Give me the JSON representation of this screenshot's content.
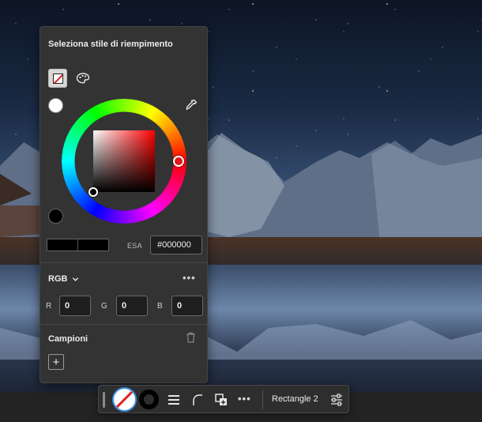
{
  "fill_panel": {
    "title": "Seleziona stile di riempimento",
    "hex_label": "ESA",
    "hex_value": "#000000",
    "color_mode": "RGB",
    "channels": [
      {
        "label": "R",
        "value": "0"
      },
      {
        "label": "G",
        "value": "0"
      },
      {
        "label": "B",
        "value": "0"
      }
    ],
    "swatches_title": "Campioni",
    "add_symbol": "+",
    "more_symbol": "•••",
    "colors": {
      "panel_bg": "#333333",
      "selected_color": "#000000",
      "hue_color": "#ff0000",
      "accent": "#3a8ee6"
    }
  },
  "toolbar": {
    "more_symbol": "•••",
    "object_name": "Rectangle 2"
  },
  "icons": {
    "fill_none": "no-fill-icon",
    "fill_palette": "palette-icon",
    "eyedropper": "eyedropper-icon",
    "dropdown": "chevron-down-icon",
    "trash": "trash-icon",
    "stroke_weight": "lines-icon",
    "corner": "corner-radius-icon",
    "boolean": "combine-shapes-icon",
    "properties": "sliders-icon"
  }
}
